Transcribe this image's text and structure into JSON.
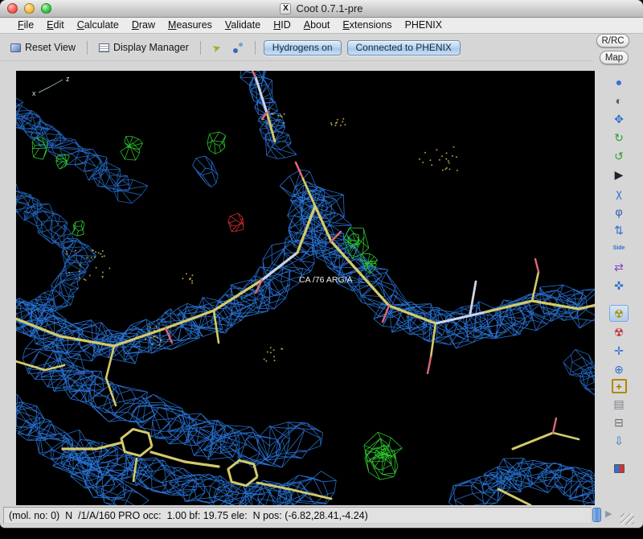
{
  "window": {
    "title": "Coot 0.7.1-pre",
    "x11_badge": "X"
  },
  "menubar": {
    "items": [
      {
        "label": "File",
        "mnemonic": 0
      },
      {
        "label": "Edit",
        "mnemonic": 0
      },
      {
        "label": "Calculate",
        "mnemonic": 0
      },
      {
        "label": "Draw",
        "mnemonic": 0
      },
      {
        "label": "Measures",
        "mnemonic": 0
      },
      {
        "label": "Validate",
        "mnemonic": 0
      },
      {
        "label": "HID",
        "mnemonic": 0
      },
      {
        "label": "About",
        "mnemonic": 0
      },
      {
        "label": "Extensions",
        "mnemonic": 0
      },
      {
        "label": "PHENIX",
        "mnemonic": -1
      }
    ]
  },
  "toolbar": {
    "reset_view_label": "Reset View",
    "display_manager_label": "Display Manager",
    "hydrogens_toggle_label": "Hydrogens on",
    "phenix_status_label": "Connected to PHENIX"
  },
  "right_rail": {
    "rrc_label": "R/RC",
    "map_label": "Map",
    "tools": [
      {
        "name": "real-space-refine-button",
        "icon": "refine-sphere-icon",
        "glyph": "●",
        "color": "#3a6fd8"
      },
      {
        "name": "regularize-button",
        "icon": "regularize-icon",
        "glyph": "◐",
        "color": "#50555c"
      },
      {
        "name": "rigid-body-fit-button",
        "icon": "rigid-body-fit-icon",
        "glyph": "✥",
        "color": "#2f6fd0"
      },
      {
        "name": "rotate-translate-button",
        "icon": "rotate-translate-icon",
        "glyph": "↻",
        "color": "#2e9e2e"
      },
      {
        "name": "auto-fit-rotamer-button",
        "icon": "auto-fit-rotamer-icon",
        "glyph": "↺",
        "color": "#2e9e2e"
      },
      {
        "name": "rotamers-button",
        "icon": "rotamers-icon",
        "glyph": "▶",
        "color": "#20242a"
      },
      {
        "name": "edit-chi-angles-button",
        "icon": "chi-angles-icon",
        "glyph": "χ",
        "color": "#2f6fd0"
      },
      {
        "name": "torsion-general-button",
        "icon": "torsion-icon",
        "glyph": "φ",
        "color": "#3558b8"
      },
      {
        "name": "flip-peptide-button",
        "icon": "flip-peptide-icon",
        "glyph": "⇅",
        "color": "#2f6fd0"
      },
      {
        "name": "side-chain-flip-button",
        "icon": "side-chain-flip-icon",
        "glyph": "Side",
        "color": "#2f6fd0",
        "small": true
      },
      {
        "name": "mutate-auto-fit-button",
        "icon": "mutate-icon",
        "glyph": "⇄",
        "color": "#8040c0"
      },
      {
        "name": "add-terminal-residue-button",
        "icon": "add-terminal-icon",
        "glyph": "✜",
        "color": "#2f6fd0"
      },
      {
        "name": "refine-residues-button",
        "icon": "radiation-icon",
        "glyph": "☢",
        "color": "#a98d00",
        "active": true,
        "gap": true
      },
      {
        "name": "run-refmac-button",
        "icon": "radiation-red-icon",
        "glyph": "☢",
        "color": "#c03030"
      },
      {
        "name": "fixed-atoms-button",
        "icon": "fixed-atoms-icon",
        "glyph": "✛",
        "color": "#2f6fd0"
      },
      {
        "name": "find-waters-button",
        "icon": "find-waters-icon",
        "glyph": "⊕",
        "color": "#2f6fd0"
      },
      {
        "name": "add-alt-conf-button",
        "icon": "plus-icon",
        "glyph": "+",
        "color": "#a07800",
        "boxed": true
      },
      {
        "name": "db-main-button",
        "icon": "grid-icon",
        "glyph": "▤",
        "color": "#7a8088"
      },
      {
        "name": "delete-item-button",
        "icon": "trash-icon",
        "glyph": "⊟",
        "color": "#666c74"
      },
      {
        "name": "undo-button",
        "icon": "down-arrow-icon",
        "glyph": "⇩",
        "color": "#2f6fd0"
      },
      {
        "name": "screenshot-button",
        "icon": "duo-flag-icon",
        "glyph": "",
        "color": "",
        "duo": true,
        "gap": true
      }
    ]
  },
  "canvas": {
    "atom_label": "CA /76 ARG/A",
    "axis_x": "x",
    "axis_z": "z",
    "colors": {
      "background": "#000000",
      "density_map": "#2b7de8",
      "difference_map_positive": "#2ecc2e",
      "difference_map_negative": "#e03030",
      "model_carbon": "#d4ca6a",
      "model_trace_light": "#ccd6ea",
      "model_oxygen": "#e06878",
      "dots": "#c8aa4a",
      "label_text": "#f0f0f0"
    }
  },
  "statusbar": {
    "text": "(mol. no: 0)  N  /1/A/160 PRO occ:  1.00 bf: 19.75 ele:  N pos: (-6.82,28.41,-4.24)"
  }
}
